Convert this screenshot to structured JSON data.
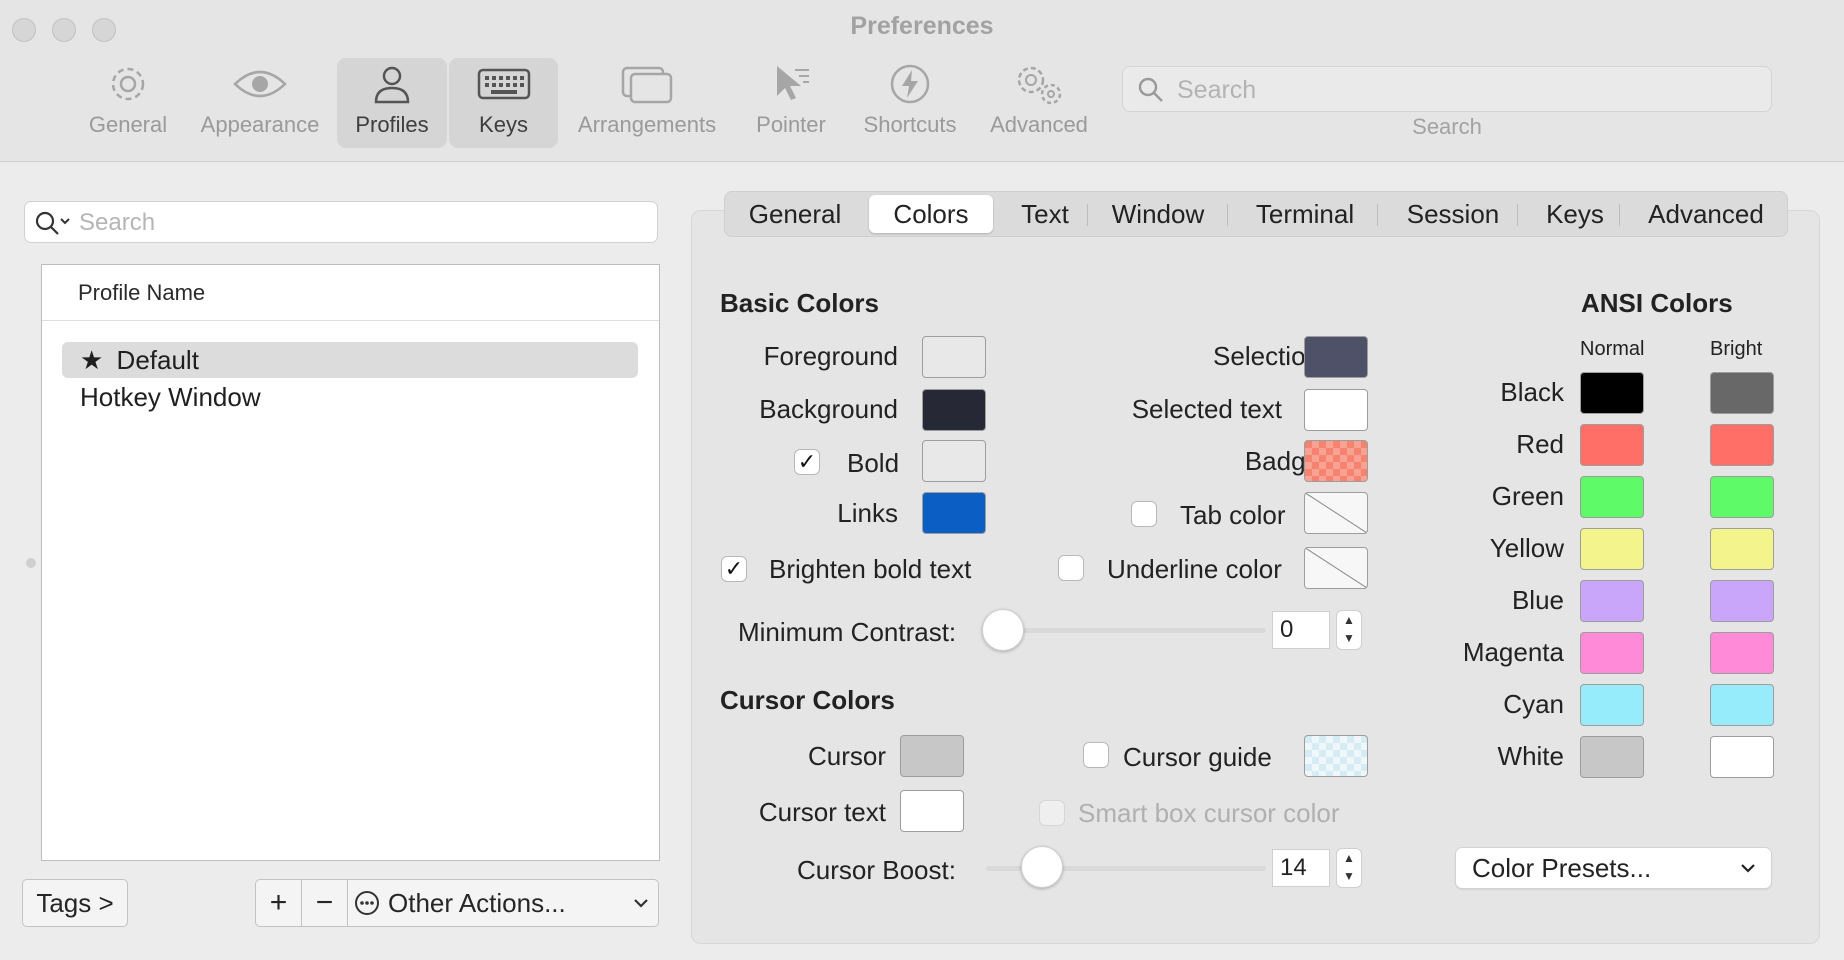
{
  "window": {
    "title": "Preferences"
  },
  "toolbar": {
    "items": [
      {
        "label": "General",
        "icon": "gear-icon"
      },
      {
        "label": "Appearance",
        "icon": "eye-icon"
      },
      {
        "label": "Profiles",
        "icon": "person-icon"
      },
      {
        "label": "Keys",
        "icon": "keyboard-icon"
      },
      {
        "label": "Arrangements",
        "icon": "windows-icon"
      },
      {
        "label": "Pointer",
        "icon": "pointer-icon"
      },
      {
        "label": "Shortcuts",
        "icon": "bolt-icon"
      },
      {
        "label": "Advanced",
        "icon": "gears-icon"
      }
    ],
    "search_placeholder": "Search",
    "search_caption": "Search"
  },
  "profiles": {
    "search_placeholder": "Search",
    "column_header": "Profile Name",
    "rows": [
      {
        "name": "Default",
        "starred": true,
        "selected": true
      },
      {
        "name": "Hotkey Window",
        "starred": false,
        "selected": false
      }
    ],
    "tags_button": "Tags >",
    "add_button": "+",
    "remove_button": "−",
    "other_actions": "Other Actions..."
  },
  "tabs": [
    "General",
    "Colors",
    "Text",
    "Window",
    "Terminal",
    "Session",
    "Keys",
    "Advanced"
  ],
  "active_tab": "Colors",
  "basic_colors": {
    "title": "Basic Colors",
    "foreground": {
      "label": "Foreground",
      "color": "#e8e8e8"
    },
    "background": {
      "label": "Background",
      "color": "#262836"
    },
    "bold": {
      "label": "Bold",
      "checked": true,
      "color": "#e8e8e8"
    },
    "links": {
      "label": "Links",
      "color": "#0b5fc4"
    },
    "selection": {
      "label": "Selection",
      "color": "#4e5168"
    },
    "selected_text": {
      "label": "Selected text",
      "color": "#ffffff"
    },
    "badge": {
      "label": "Badge",
      "color": "#f5836f"
    },
    "tab_color": {
      "label": "Tab color",
      "checked": false
    },
    "underline_color": {
      "label": "Underline color",
      "checked": false
    },
    "brighten_bold": {
      "label": "Brighten bold text",
      "checked": true
    },
    "min_contrast": {
      "label": "Minimum Contrast:",
      "value": "0",
      "fraction": 0
    }
  },
  "cursor_colors": {
    "title": "Cursor Colors",
    "cursor": {
      "label": "Cursor",
      "color": "#c7c7c7"
    },
    "cursor_text": {
      "label": "Cursor text",
      "color": "#ffffff"
    },
    "cursor_guide": {
      "label": "Cursor guide",
      "checked": false,
      "color": "#d6ecf5"
    },
    "smart_box": {
      "label": "Smart box cursor color",
      "checked": false
    },
    "boost": {
      "label": "Cursor Boost:",
      "value": "14",
      "fraction": 0.14
    }
  },
  "ansi": {
    "title": "ANSI Colors",
    "normal_header": "Normal",
    "bright_header": "Bright",
    "rows": [
      {
        "name": "Black",
        "normal": "#000000",
        "bright": "#686868"
      },
      {
        "name": "Red",
        "normal": "#ff6e67",
        "bright": "#ff6e67"
      },
      {
        "name": "Green",
        "normal": "#5ffa68",
        "bright": "#5ffa68"
      },
      {
        "name": "Yellow",
        "normal": "#f4f48c",
        "bright": "#f4f48c"
      },
      {
        "name": "Blue",
        "normal": "#c9a6fa",
        "bright": "#c9a6fa"
      },
      {
        "name": "Magenta",
        "normal": "#ff8ad8",
        "bright": "#ff8ad8"
      },
      {
        "name": "Cyan",
        "normal": "#96ecfa",
        "bright": "#96ecfa"
      },
      {
        "name": "White",
        "normal": "#c7c7c7",
        "bright": "#ffffff"
      }
    ],
    "presets_label": "Color Presets..."
  }
}
